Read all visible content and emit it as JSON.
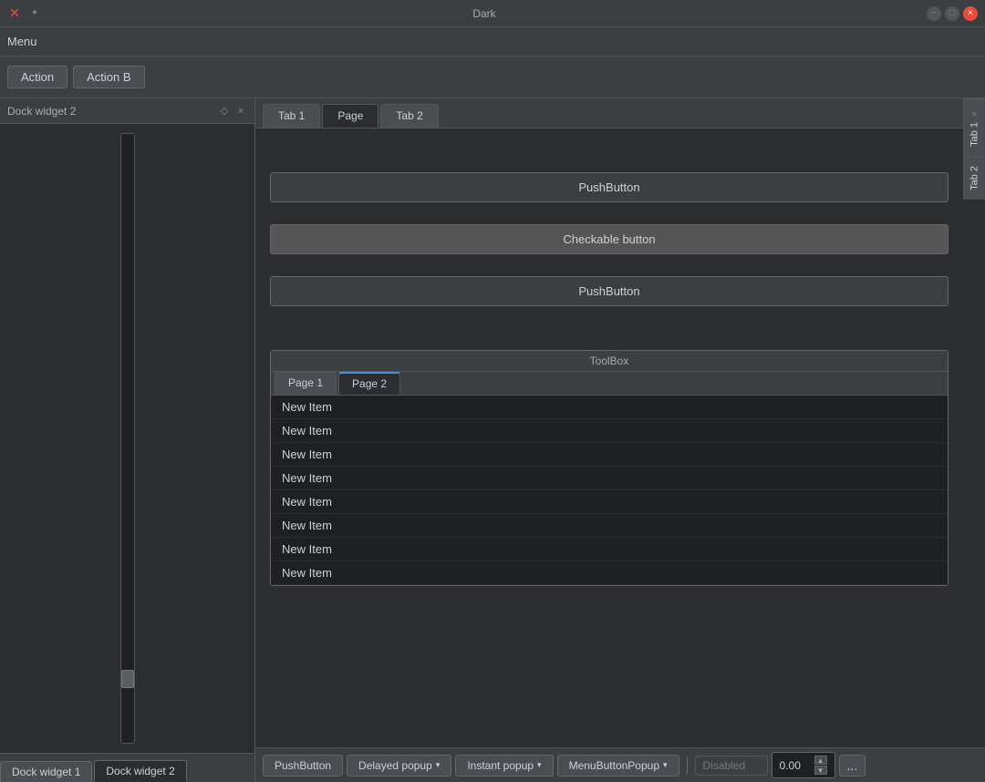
{
  "titleBar": {
    "title": "Dark",
    "closeLabel": "×",
    "minLabel": "−",
    "maxLabel": "□"
  },
  "menuBar": {
    "label": "Menu"
  },
  "actions": {
    "action1": "Action",
    "action2": "Action B"
  },
  "leftDock": {
    "title": "Dock widget 2",
    "pinIcon": "◇",
    "closeIcon": "×"
  },
  "tabs": {
    "tab1": "Tab 1",
    "tab2": "Page",
    "tab3": "Tab 2"
  },
  "sideTabs": {
    "tab1": "Tab 1",
    "tab2": "Tab 2"
  },
  "buttons": {
    "pushButton1": "PushButton",
    "checkableButton": "Checkable button",
    "pushButton2": "PushButton"
  },
  "toolbox": {
    "label": "ToolBox",
    "page1": "Page 1",
    "page2": "Page 2",
    "items": [
      "New Item",
      "New Item",
      "New Item",
      "New Item",
      "New Item",
      "New Item",
      "New Item",
      "New Item"
    ]
  },
  "bottomToolbar": {
    "pushButton": "PushButton",
    "delayedPopup": "Delayed popup",
    "instantPopup": "Instant popup",
    "menuButtonPopup": "MenuButtonPopup",
    "disabledLabel": "Disabled",
    "numberValue": "0.00",
    "moreButton": "..."
  },
  "bottomDockTabs": {
    "tab1": "Dock widget 1",
    "tab2": "Dock widget 2"
  }
}
